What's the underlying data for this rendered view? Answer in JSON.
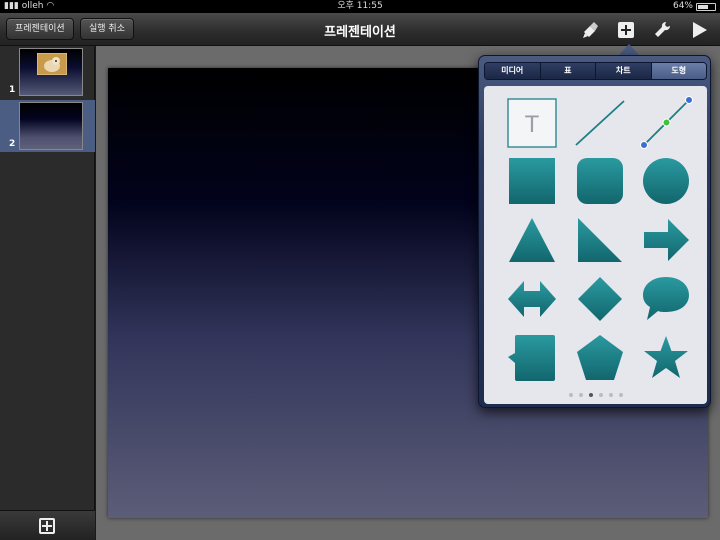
{
  "status_bar": {
    "carrier": "olleh",
    "time": "오후 11:55",
    "battery": "64%",
    "battery_level": 0.64
  },
  "toolbar": {
    "presentations_label": "프레젠테이션",
    "undo_label": "실행 취소",
    "title": "프레젠테이션",
    "icons": [
      "paintbrush-icon",
      "insert-icon",
      "wrench-icon",
      "play-icon"
    ]
  },
  "sidebar": {
    "slides": [
      {
        "number": "1",
        "selected": false
      },
      {
        "number": "2",
        "selected": true
      }
    ],
    "add_icon": "add-slide-icon"
  },
  "popover": {
    "tabs": [
      "미디어",
      "표",
      "차트",
      "도형"
    ],
    "active_tab": "도형",
    "text_box_glyph": "T",
    "shape_color": "#1e7f86",
    "shapes": [
      "text-box",
      "line",
      "connection-line",
      "square",
      "rounded-square",
      "circle",
      "triangle",
      "right-triangle",
      "arrow",
      "double-arrow",
      "diamond",
      "speech-bubble",
      "callout-square",
      "pentagon",
      "star"
    ],
    "page_count": 6,
    "current_page": 3
  }
}
